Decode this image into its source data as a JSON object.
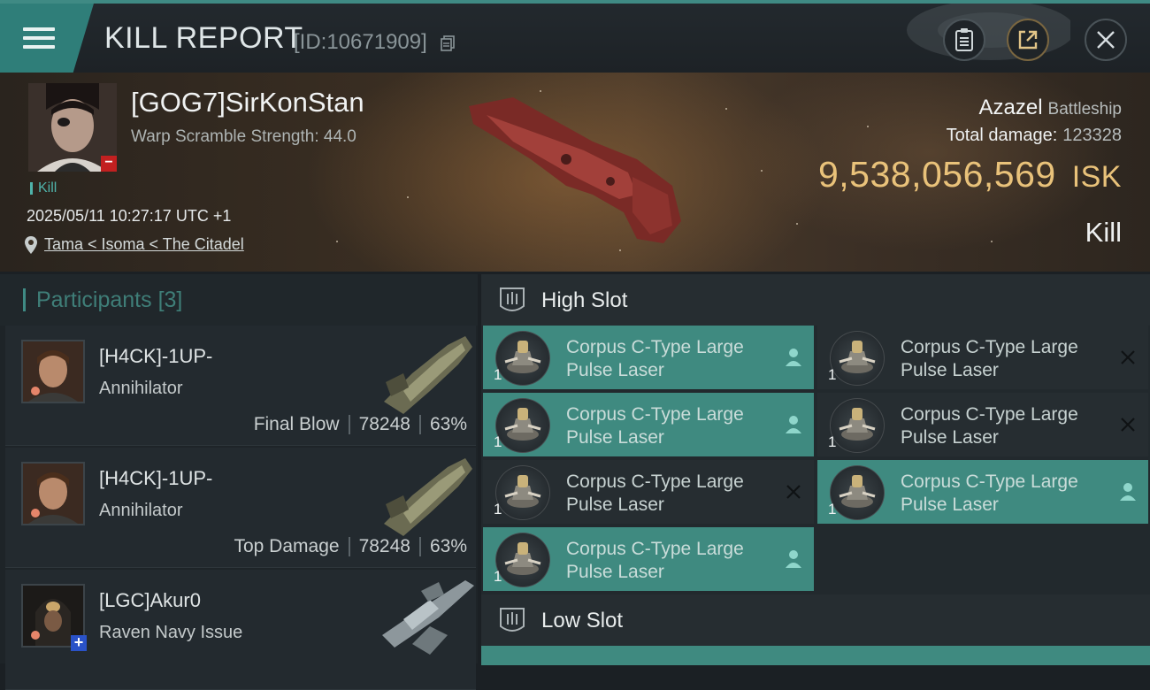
{
  "header": {
    "title": "KILL REPORT",
    "report_id": "[ID:10671909]"
  },
  "victim": {
    "name": "[GOG7]SirKonStan",
    "warp_scramble": "Warp Scramble Strength: 44.0",
    "kill_tag": "Kill",
    "time": "2025/05/11 10:27:17 UTC +1",
    "location": "Tama < Isoma < The Citadel",
    "ship_name": "Azazel",
    "ship_class": "Battleship",
    "total_damage_label": "Total damage:",
    "total_damage_value": "123328",
    "isk_value": "9,538,056,569",
    "isk_unit": "ISK",
    "result": "Kill"
  },
  "participants": {
    "label": "Participants",
    "count": "[3]",
    "items": [
      {
        "name": "[H4CK]-1UP-",
        "ship": "Annihilator",
        "tag": "Final Blow",
        "damage": "78248",
        "percent": "63%"
      },
      {
        "name": "[H4CK]-1UP-",
        "ship": "Annihilator",
        "tag": "Top Damage",
        "damage": "78248",
        "percent": "63%"
      },
      {
        "name": "[LGC]Akur0",
        "ship": "Raven Navy Issue"
      }
    ]
  },
  "high_slot": {
    "label": "High Slot",
    "modules": [
      {
        "line1": "Corpus C-Type Large",
        "line2": "Pulse Laser",
        "qty": "1",
        "status": "pilot-icon",
        "style": "teal"
      },
      {
        "line1": "Corpus C-Type Large",
        "line2": "Pulse Laser",
        "qty": "1",
        "status": "close-icon",
        "style": "dark"
      },
      {
        "line1": "Corpus C-Type Large",
        "line2": "Pulse Laser",
        "qty": "1",
        "status": "pilot-icon",
        "style": "teal"
      },
      {
        "line1": "Corpus C-Type Large",
        "line2": "Pulse Laser",
        "qty": "1",
        "status": "close-icon",
        "style": "dark"
      },
      {
        "line1": "Corpus C-Type Large",
        "line2": "Pulse Laser",
        "qty": "1",
        "status": "close-icon",
        "style": "dark"
      },
      {
        "line1": "Corpus C-Type Large",
        "line2": "Pulse Laser",
        "qty": "1",
        "status": "pilot-icon",
        "style": "teal"
      },
      {
        "line1": "Corpus C-Type Large",
        "line2": "Pulse Laser",
        "qty": "1",
        "status": "pilot-icon",
        "style": "teal"
      }
    ]
  },
  "low_slot": {
    "label": "Low Slot"
  },
  "colors": {
    "accent_teal": "#3f8a80",
    "isk_gold": "#e9c27a",
    "badge_red": "#c22020",
    "badge_blue": "#2a52c8"
  }
}
